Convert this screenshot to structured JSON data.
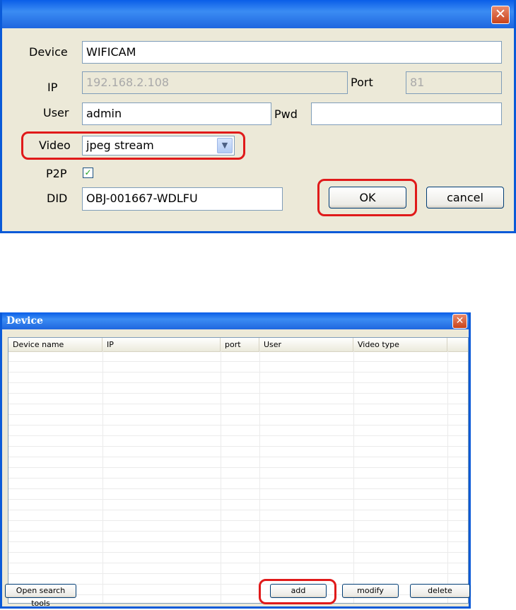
{
  "device_dialog": {
    "labels": {
      "device": "Device",
      "ip": "IP",
      "port": "Port",
      "user": "User",
      "pwd": "Pwd",
      "video": "Video",
      "p2p": "P2P",
      "did": "DID"
    },
    "values": {
      "device": "WIFICAM",
      "ip": "192.168.2.108",
      "port": "81",
      "user": "admin",
      "pwd": "",
      "video": "jpeg stream",
      "p2p_checked": true,
      "did": "OBJ-001667-WDLFU"
    },
    "buttons": {
      "ok": "OK",
      "cancel": "cancel"
    }
  },
  "device_list_window": {
    "title": "Device",
    "columns": [
      "Device name",
      "IP",
      "port",
      "User",
      "Video type"
    ],
    "rows": [],
    "buttons": {
      "open_search_tools": "Open search tools",
      "add": "add",
      "modify": "modify",
      "delete": "delete"
    }
  },
  "colors": {
    "highlight": "#e01a1a",
    "titlebar": "#0a5ee8",
    "window_bg": "#ece9d8"
  },
  "icons": [
    "close-icon",
    "chevron-down-icon",
    "checkmark-icon"
  ]
}
